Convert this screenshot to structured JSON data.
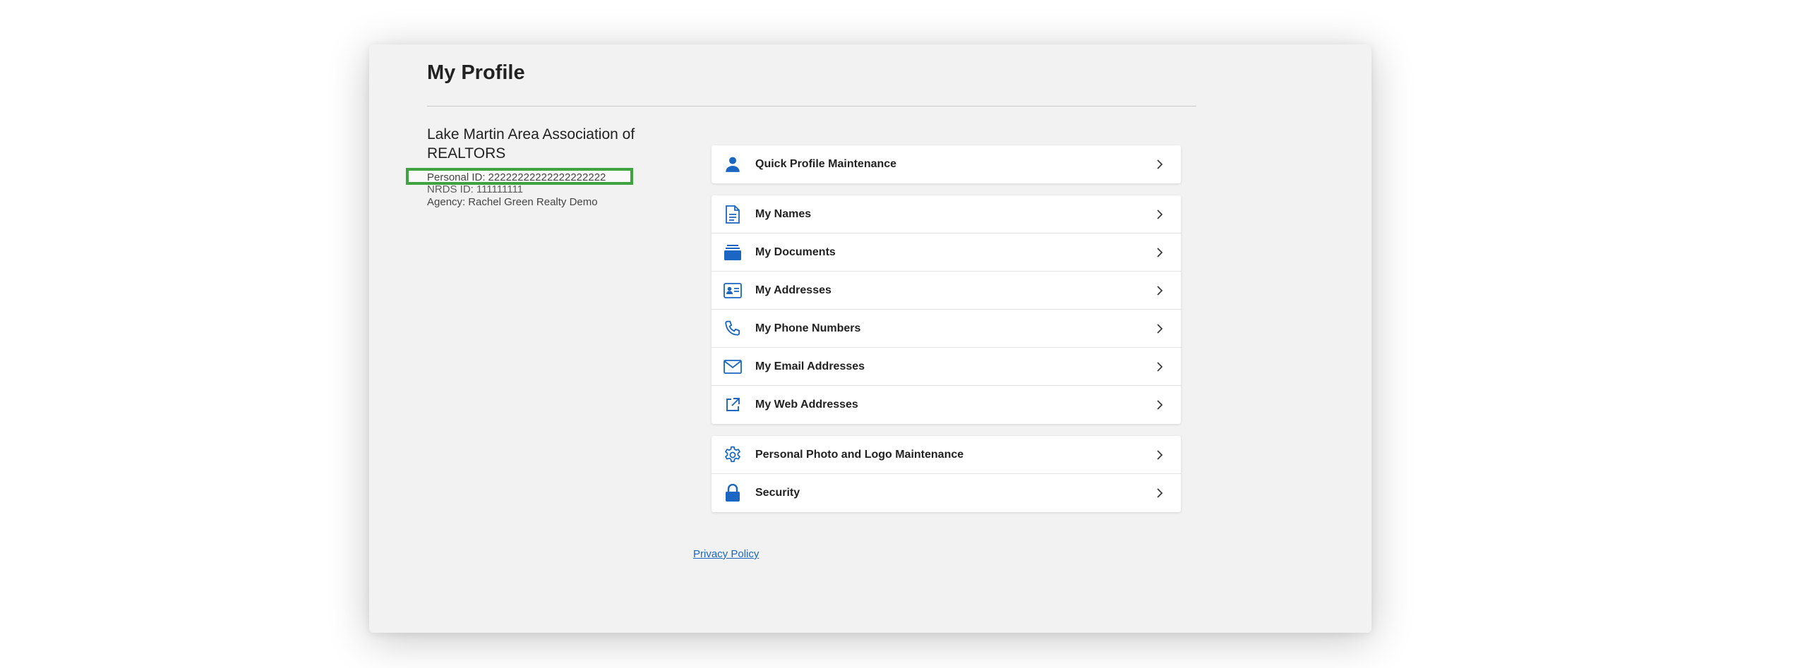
{
  "page": {
    "title": "My Profile"
  },
  "profile": {
    "org_name": "Lake Martin Area Association of REALTORS",
    "personal_id_label": "Personal ID:",
    "personal_id_value": "22222222222222222222",
    "nrds_id_label": "NRDS ID:",
    "nrds_id_value": "111111111",
    "agency_label": "Agency:",
    "agency_value": "Rachel Green Realty Demo"
  },
  "menu": {
    "groups": [
      {
        "items": [
          {
            "label": "Quick Profile Maintenance",
            "icon": "person-icon"
          }
        ]
      },
      {
        "items": [
          {
            "label": "My Names",
            "icon": "document-icon"
          },
          {
            "label": "My Documents",
            "icon": "folder-stack-icon"
          },
          {
            "label": "My Addresses",
            "icon": "contact-card-icon"
          },
          {
            "label": "My Phone Numbers",
            "icon": "phone-icon"
          },
          {
            "label": "My Email Addresses",
            "icon": "envelope-icon"
          },
          {
            "label": "My Web Addresses",
            "icon": "external-link-icon"
          }
        ]
      },
      {
        "items": [
          {
            "label": "Personal Photo and Logo Maintenance",
            "icon": "gear-icon"
          },
          {
            "label": "Security",
            "icon": "lock-icon"
          }
        ]
      }
    ]
  },
  "footer": {
    "privacy_label": "Privacy Policy"
  },
  "colors": {
    "accent": "#1a66c2",
    "highlight": "#3fa33f",
    "panel_bg": "#f2f2f2"
  }
}
